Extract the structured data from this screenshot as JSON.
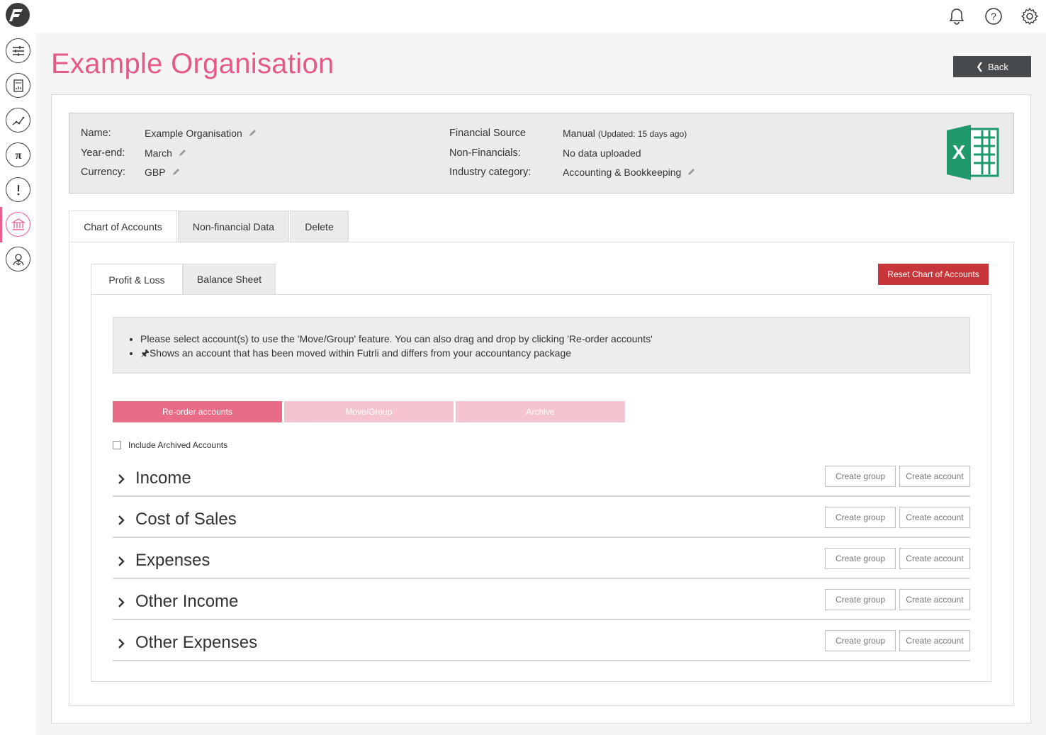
{
  "topbar": {
    "icons": [
      "bell-icon",
      "help-icon",
      "settings-icon"
    ]
  },
  "sidebar": {
    "items": [
      {
        "icon": "sliders-icon"
      },
      {
        "icon": "pdf-report-icon"
      },
      {
        "icon": "trend-line-icon"
      },
      {
        "icon": "pi-icon"
      },
      {
        "icon": "alert-icon"
      },
      {
        "icon": "bank-icon",
        "active": true
      },
      {
        "icon": "user-network-icon"
      }
    ]
  },
  "page": {
    "title": "Example Organisation",
    "back_label": "Back"
  },
  "info": {
    "name_label": "Name:",
    "name_value": "Example Organisation",
    "yearend_label": "Year-end:",
    "yearend_value": "March",
    "currency_label": "Currency:",
    "currency_value": "GBP",
    "source_label": "Financial Source",
    "source_value": "Manual",
    "source_updated": "(Updated: 15 days ago)",
    "nonfin_label": "Non-Financials:",
    "nonfin_value": "No data uploaded",
    "industry_label": "Industry category:",
    "industry_value": "Accounting & Bookkeeping"
  },
  "tabs": {
    "outer": [
      "Chart of Accounts",
      "Non-financial Data",
      "Delete"
    ],
    "inner": [
      "Profit & Loss",
      "Balance Sheet"
    ]
  },
  "reset_label": "Reset Chart of Accounts",
  "notice": {
    "line1": "Please select account(s) to use the 'Move/Group' feature. You can also drag and drop by clicking 'Re-order accounts'",
    "line2": "Shows an account that has been moved within Futrli and differs from your accountancy package"
  },
  "actions": {
    "reorder": "Re-order accounts",
    "move": "Move/Group",
    "archive": "Archive"
  },
  "include_archived": "Include Archived Accounts",
  "sections": [
    "Income",
    "Cost of Sales",
    "Expenses",
    "Other Income",
    "Other Expenses"
  ],
  "section_buttons": {
    "create_group": "Create group",
    "create_account": "Create account"
  },
  "colors": {
    "brand_pink": "#e4588a",
    "primary_button": "#e96c86",
    "disabled_button": "#f5c5cf",
    "danger": "#c8363a",
    "back_button": "#474a4d"
  }
}
